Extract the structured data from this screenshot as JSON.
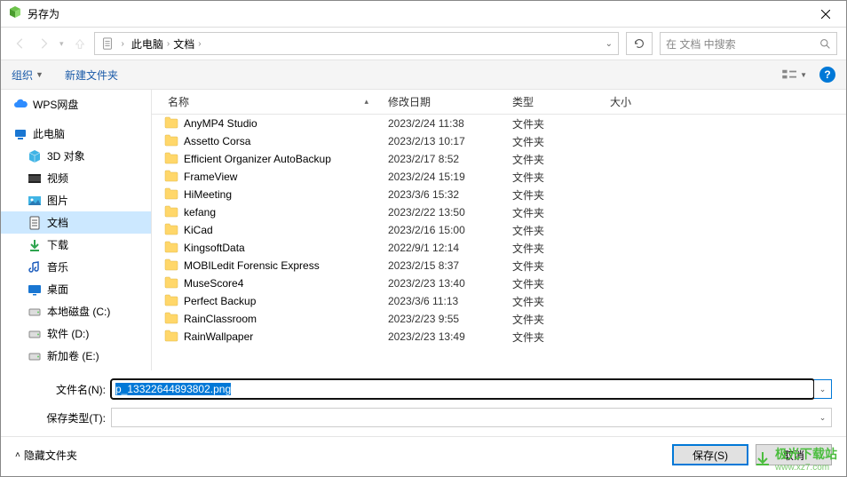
{
  "window": {
    "title": "另存为"
  },
  "nav": {
    "breadcrumb": [
      "此电脑",
      "文档"
    ]
  },
  "search": {
    "placeholder": "在 文档 中搜索"
  },
  "toolbar": {
    "organize": "组织",
    "new_folder": "新建文件夹"
  },
  "sidebar": {
    "items": [
      {
        "label": "WPS网盘",
        "icon": "cloud",
        "color": "#2e8cff",
        "indent": false
      },
      {
        "label": "此电脑",
        "icon": "pc",
        "color": "#1976d2",
        "indent": false
      },
      {
        "label": "3D 对象",
        "icon": "cube",
        "color": "#40b4e5",
        "indent": true
      },
      {
        "label": "视频",
        "icon": "video",
        "color": "#444",
        "indent": true
      },
      {
        "label": "图片",
        "icon": "image",
        "color": "#40b4e5",
        "indent": true
      },
      {
        "label": "文档",
        "icon": "doc",
        "color": "#555",
        "indent": true,
        "selected": true
      },
      {
        "label": "下载",
        "icon": "download",
        "color": "#2ea44f",
        "indent": true
      },
      {
        "label": "音乐",
        "icon": "music",
        "color": "#1e5ebd",
        "indent": true
      },
      {
        "label": "桌面",
        "icon": "desktop",
        "color": "#1976d2",
        "indent": true
      },
      {
        "label": "本地磁盘 (C:)",
        "icon": "disk",
        "color": "#888",
        "indent": true
      },
      {
        "label": "软件 (D:)",
        "icon": "disk",
        "color": "#888",
        "indent": true
      },
      {
        "label": "新加卷 (E:)",
        "icon": "disk",
        "color": "#888",
        "indent": true
      }
    ]
  },
  "columns": {
    "name": "名称",
    "date": "修改日期",
    "type": "类型",
    "size": "大小"
  },
  "files": [
    {
      "name": "AnyMP4 Studio",
      "date": "2023/2/24 11:38",
      "type": "文件夹"
    },
    {
      "name": "Assetto Corsa",
      "date": "2023/2/13 10:17",
      "type": "文件夹"
    },
    {
      "name": "Efficient Organizer AutoBackup",
      "date": "2023/2/17 8:52",
      "type": "文件夹"
    },
    {
      "name": "FrameView",
      "date": "2023/2/24 15:19",
      "type": "文件夹"
    },
    {
      "name": "HiMeeting",
      "date": "2023/3/6 15:32",
      "type": "文件夹"
    },
    {
      "name": "kefang",
      "date": "2023/2/22 13:50",
      "type": "文件夹"
    },
    {
      "name": "KiCad",
      "date": "2023/2/16 15:00",
      "type": "文件夹"
    },
    {
      "name": "KingsoftData",
      "date": "2022/9/1 12:14",
      "type": "文件夹"
    },
    {
      "name": "MOBILedit Forensic Express",
      "date": "2023/2/15 8:37",
      "type": "文件夹"
    },
    {
      "name": "MuseScore4",
      "date": "2023/2/23 13:40",
      "type": "文件夹"
    },
    {
      "name": "Perfect Backup",
      "date": "2023/3/6 11:13",
      "type": "文件夹"
    },
    {
      "name": "RainClassroom",
      "date": "2023/2/23 9:55",
      "type": "文件夹"
    },
    {
      "name": "RainWallpaper",
      "date": "2023/2/23 13:49",
      "type": "文件夹"
    }
  ],
  "form": {
    "filename_label": "文件名(N):",
    "filename_value": "p_13322644893802.png",
    "filetype_label": "保存类型(T):",
    "filetype_value": ""
  },
  "footer": {
    "hide_folders": "隐藏文件夹",
    "save": "保存(S)",
    "cancel": "取消"
  },
  "watermark": {
    "text": "极光下载站",
    "sub": "www.xz7.com"
  }
}
